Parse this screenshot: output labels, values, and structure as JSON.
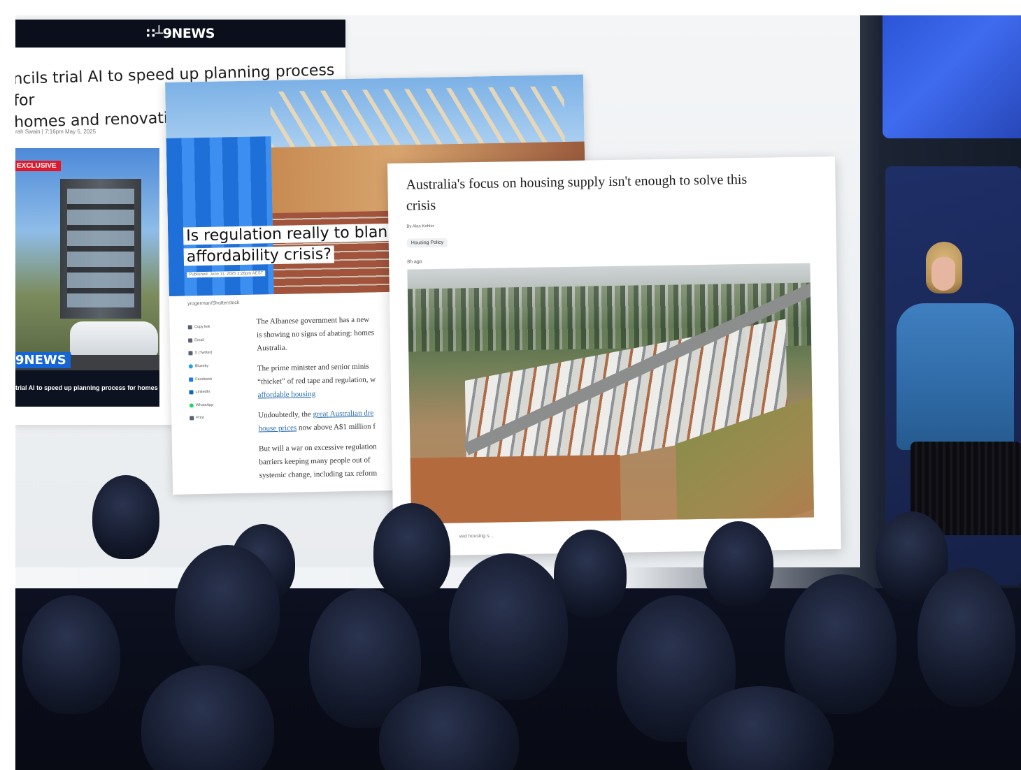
{
  "news9": {
    "logo": "∷┴9NEWS",
    "headline_line1": "ncils trial AI to speed up planning process for",
    "headline_line2": "homes and renovatic",
    "byline": "rah Swain  |  7:16pm May 5, 2025",
    "badge_exclusive": "EXCLUSIVE",
    "badge_logo": "9NEWS",
    "ticker": "trial AI to speed up planning process for homes"
  },
  "regulation": {
    "title_line1": "Is regulation really to blan",
    "title_line2": "affordability crisis?",
    "published": "Published: June 11, 2025 2:26pm AEST",
    "photo_credit": "yrogerman/Shutterstock",
    "share_items": [
      "Copy link",
      "Email",
      "X (Twitter)",
      "Bluesky",
      "Facebook",
      "LinkedIn",
      "WhatsApp",
      "Print"
    ],
    "para1_line1": "The Albanese government has a new",
    "para1_line2": "is showing no signs of abating: homes",
    "para1_line3": "Australia.",
    "para2_line1": "The prime minister and senior minis",
    "para2_line2": "“thicket” of red tape and regulation, w",
    "para2_link": "affordable housing",
    "para3_prefix": "Undoubtedly, the ",
    "para3_link1": "great Australian dre",
    "para3_link2": "house prices",
    "para3_suffix": " now above A$1 million f",
    "para4_line1": "But will a war on excessive regulation",
    "para4_line2": "barriers keeping many people out of",
    "para4_line3": "systemic change, including tax reform"
  },
  "housing": {
    "title_line1": "Australia's focus on housing supply isn't enough to solve this",
    "title_line2": "crisis",
    "byline": "By Alan Kohler",
    "tag": "Housing Policy",
    "ago": "8h ago",
    "caption": "ved housing s..."
  },
  "colors": {
    "news_bar": "#0b0f1c",
    "exclusive_badge": "#e0182a",
    "news_badge": "#1466d6",
    "link": "#2a6db0",
    "presenter_shirt": "#3f7fc0"
  },
  "icons": [
    "link-icon",
    "email-icon",
    "x-icon",
    "bluesky-icon",
    "facebook-icon",
    "linkedin-icon",
    "whatsapp-icon",
    "print-icon"
  ]
}
